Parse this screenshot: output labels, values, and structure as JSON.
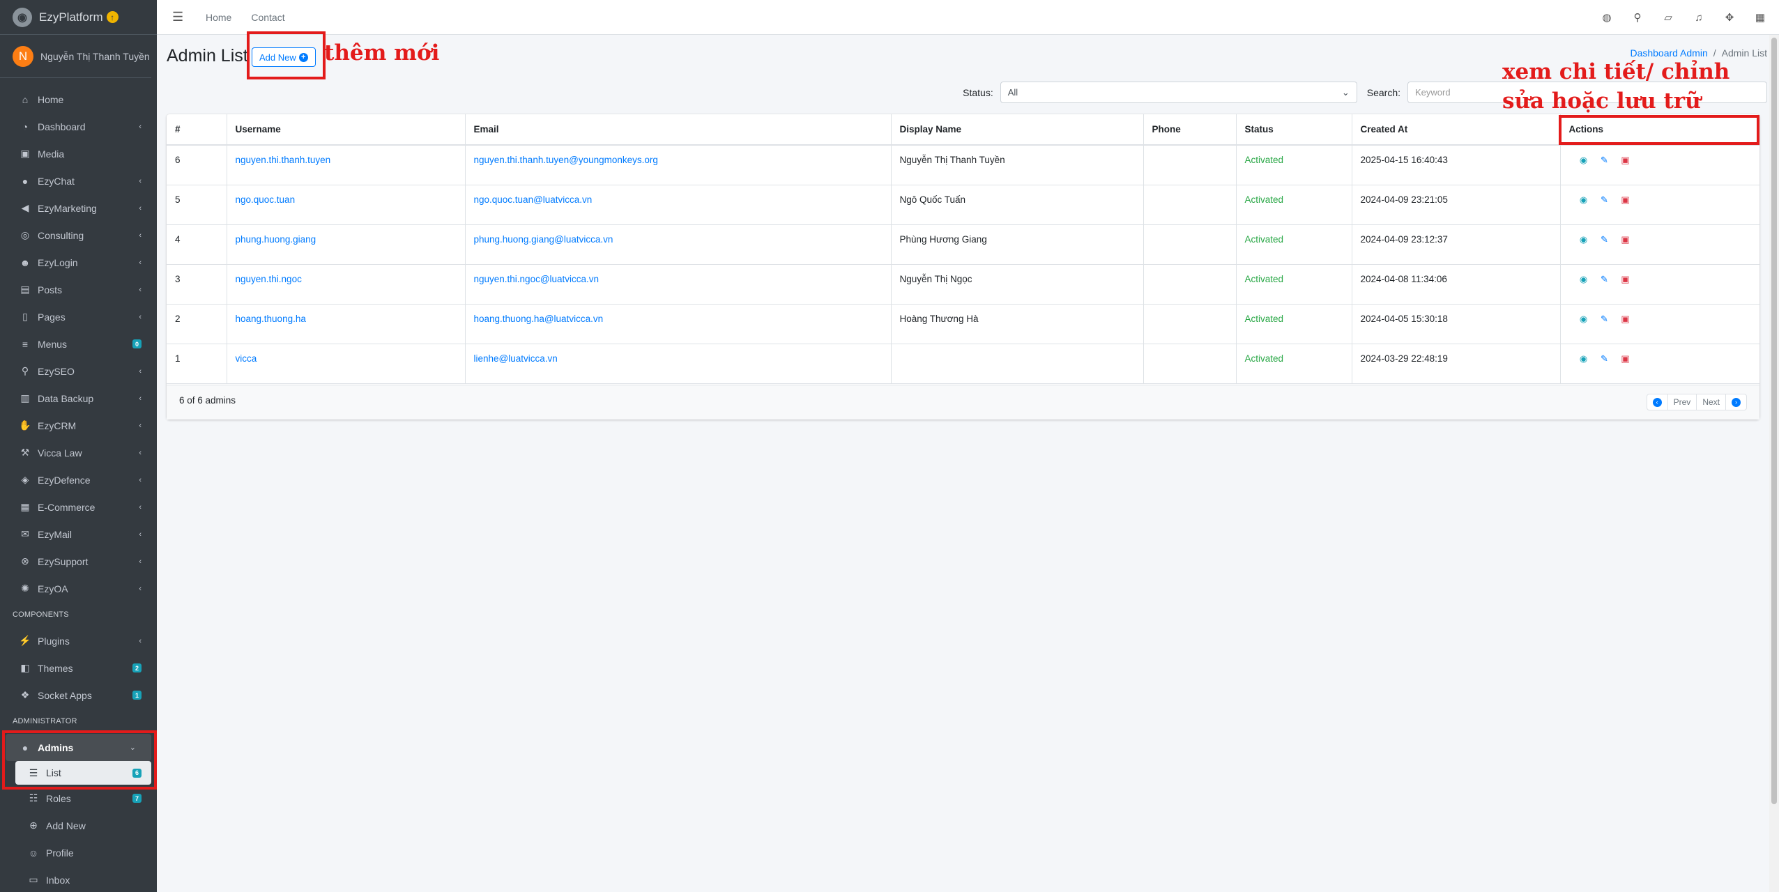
{
  "brand": {
    "name": "EzyPlatform",
    "badge": "↑"
  },
  "user": {
    "initial": "N",
    "name": "Nguyễn Thị Thanh Tuyền"
  },
  "sidebar": {
    "items": [
      {
        "label": "Home",
        "icon": "home-icon",
        "glyph": "⌂"
      },
      {
        "label": "Dashboard",
        "icon": "dashboard-icon",
        "glyph": "◔",
        "arrow": "‹"
      },
      {
        "label": "Media",
        "icon": "image-icon",
        "glyph": "▣"
      },
      {
        "label": "EzyChat",
        "icon": "chat-icon",
        "glyph": "●",
        "arrow": "‹"
      },
      {
        "label": "EzyMarketing",
        "icon": "bullhorn-icon",
        "glyph": "◀",
        "arrow": "‹"
      },
      {
        "label": "Consulting",
        "icon": "headset-icon",
        "glyph": "◎",
        "arrow": "‹"
      },
      {
        "label": "EzyLogin",
        "icon": "user-lock-icon",
        "glyph": "☻",
        "arrow": "‹"
      },
      {
        "label": "Posts",
        "icon": "newspaper-icon",
        "glyph": "▤",
        "arrow": "‹"
      },
      {
        "label": "Pages",
        "icon": "file-icon",
        "glyph": "▯",
        "arrow": "‹"
      },
      {
        "label": "Menus",
        "icon": "bars-icon",
        "glyph": "≡",
        "badge": "0"
      },
      {
        "label": "EzySEO",
        "icon": "search-plus-icon",
        "glyph": "⚲",
        "arrow": "‹"
      },
      {
        "label": "Data Backup",
        "icon": "database-icon",
        "glyph": "▥",
        "arrow": "‹"
      },
      {
        "label": "EzyCRM",
        "icon": "handshake-icon",
        "glyph": "✋",
        "arrow": "‹"
      },
      {
        "label": "Vicca Law",
        "icon": "gavel-icon",
        "glyph": "⚒",
        "arrow": "‹"
      },
      {
        "label": "EzyDefence",
        "icon": "shield-icon",
        "glyph": "◈",
        "arrow": "‹"
      },
      {
        "label": "E-Commerce",
        "icon": "store-icon",
        "glyph": "▦",
        "arrow": "‹"
      },
      {
        "label": "EzyMail",
        "icon": "envelope-icon",
        "glyph": "✉",
        "arrow": "‹"
      },
      {
        "label": "EzySupport",
        "icon": "lifebuoy-icon",
        "glyph": "⊗",
        "arrow": "‹"
      },
      {
        "label": "EzyOA",
        "icon": "gear-icon",
        "glyph": "✺",
        "arrow": "‹"
      }
    ],
    "components_header": "COMPONENTS",
    "components": [
      {
        "label": "Plugins",
        "icon": "plug-icon",
        "glyph": "⚡",
        "arrow": "‹"
      },
      {
        "label": "Themes",
        "icon": "palette-icon",
        "glyph": "◧",
        "badge": "2"
      },
      {
        "label": "Socket Apps",
        "icon": "cubes-icon",
        "glyph": "❖",
        "badge": "1"
      }
    ],
    "admin_header": "ADMINISTRATOR",
    "admins": {
      "label": "Admins",
      "icon": "user-circle-icon",
      "glyph": "●",
      "arrow": "⌄"
    },
    "admin_children": [
      {
        "label": "List",
        "icon": "list-icon",
        "glyph": "☰",
        "badge": "6",
        "active": true
      },
      {
        "label": "Roles",
        "icon": "users-icon",
        "glyph": "☷",
        "badge": "7"
      },
      {
        "label": "Add New",
        "icon": "plus-circle-icon",
        "glyph": "⊕"
      },
      {
        "label": "Profile",
        "icon": "user-icon",
        "glyph": "☺"
      },
      {
        "label": "Inbox",
        "icon": "inbox-icon",
        "glyph": "▭"
      }
    ]
  },
  "topbar": {
    "links": [
      "Home",
      "Contact"
    ],
    "icons": [
      {
        "name": "language-icon",
        "glyph": "◍"
      },
      {
        "name": "search-icon",
        "glyph": "⚲"
      },
      {
        "name": "comments-icon",
        "glyph": "▱"
      },
      {
        "name": "bell-icon",
        "glyph": "♫"
      },
      {
        "name": "expand-icon",
        "glyph": "✥"
      },
      {
        "name": "apps-grid-icon",
        "glyph": "▦"
      }
    ]
  },
  "page": {
    "title": "Admin List",
    "add_new": "Add New",
    "breadcrumb": {
      "link": "Dashboard Admin",
      "separator": "/",
      "current": "Admin List"
    }
  },
  "annotations": {
    "add_note": "thêm mới",
    "actions_note_line1": "xem chi tiết/ chỉnh",
    "actions_note_line2": "sửa hoặc lưu trữ"
  },
  "filters": {
    "status_label": "Status:",
    "status_value": "All",
    "search_label": "Search:",
    "search_placeholder": "Keyword"
  },
  "table": {
    "headers": [
      "#",
      "Username",
      "Email",
      "Display Name",
      "Phone",
      "Status",
      "Created At",
      "Actions"
    ],
    "rows": [
      {
        "id": "6",
        "username": "nguyen.thi.thanh.tuyen",
        "email": "nguyen.thi.thanh.tuyen@youngmonkeys.org",
        "display_name": "Nguyễn Thị Thanh Tuyền",
        "phone": "",
        "status": "Activated",
        "created_at": "2025-04-15 16:40:43"
      },
      {
        "id": "5",
        "username": "ngo.quoc.tuan",
        "email": "ngo.quoc.tuan@luatvicca.vn",
        "display_name": "Ngô Quốc Tuấn",
        "phone": "",
        "status": "Activated",
        "created_at": "2024-04-09 23:21:05"
      },
      {
        "id": "4",
        "username": "phung.huong.giang",
        "email": "phung.huong.giang@luatvicca.vn",
        "display_name": "Phùng Hương Giang",
        "phone": "",
        "status": "Activated",
        "created_at": "2024-04-09 23:12:37"
      },
      {
        "id": "3",
        "username": "nguyen.thi.ngoc",
        "email": "nguyen.thi.ngoc@luatvicca.vn",
        "display_name": "Nguyễn Thị Ngọc",
        "phone": "",
        "status": "Activated",
        "created_at": "2024-04-08 11:34:06"
      },
      {
        "id": "2",
        "username": "hoang.thuong.ha",
        "email": "hoang.thuong.ha@luatvicca.vn",
        "display_name": "Hoàng Thương Hà",
        "phone": "",
        "status": "Activated",
        "created_at": "2024-04-05 15:30:18"
      },
      {
        "id": "1",
        "username": "vicca",
        "email": "lienhe@luatvicca.vn",
        "display_name": "",
        "phone": "",
        "status": "Activated",
        "created_at": "2024-03-29 22:48:19"
      }
    ],
    "footer_count": "6 of 6 admins",
    "pager": {
      "prev": "Prev",
      "next": "Next"
    }
  },
  "colors": {
    "sidebar_bg": "#343a40",
    "primary": "#007bff",
    "success": "#28a745",
    "danger": "#dc3545",
    "info": "#17a2b8",
    "annotation": "#e31b1b"
  }
}
